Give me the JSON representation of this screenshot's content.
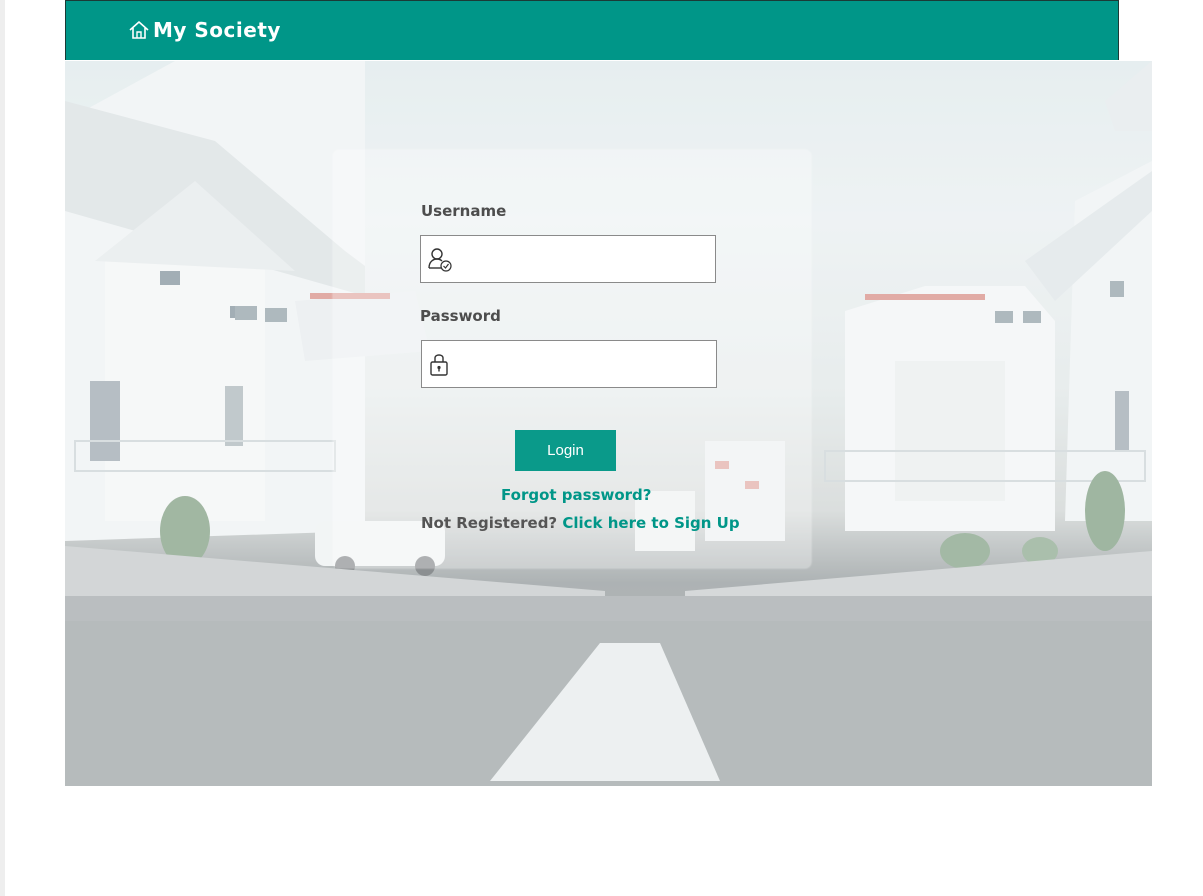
{
  "navbar": {
    "brand": "My Society",
    "brand_icon": "home-icon",
    "color": "#009688"
  },
  "login_form": {
    "username_label": "Username",
    "username_icon": "user-check-icon",
    "username_value": "",
    "password_label": "Password",
    "password_icon": "lock-icon",
    "password_value": "",
    "login_button": "Login",
    "forgot_password": "Forgot password?",
    "not_registered": "Not Registered?",
    "sign_up_link": "Click here to Sign Up",
    "accent": "#009688"
  }
}
